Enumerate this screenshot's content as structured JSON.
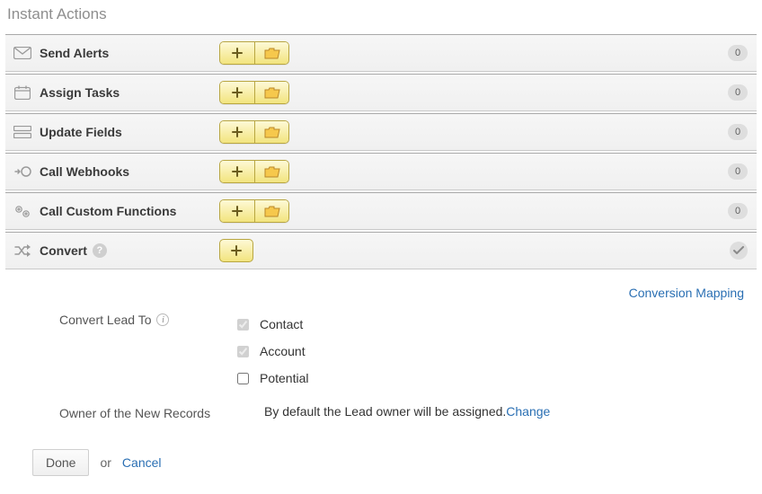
{
  "title": "Instant Actions",
  "rows": [
    {
      "label": "Send Alerts",
      "count": "0"
    },
    {
      "label": "Assign Tasks",
      "count": "0"
    },
    {
      "label": "Update Fields",
      "count": "0"
    },
    {
      "label": "Call Webhooks",
      "count": "0"
    },
    {
      "label": "Call Custom Functions",
      "count": "0"
    }
  ],
  "convert": {
    "label": "Convert",
    "mapping_link": "Conversion Mapping",
    "lead_to_label": "Convert Lead To",
    "options": {
      "contact": {
        "label": "Contact",
        "checked": true,
        "disabled": true
      },
      "account": {
        "label": "Account",
        "checked": true,
        "disabled": true
      },
      "potential": {
        "label": "Potential",
        "checked": false,
        "disabled": false
      }
    },
    "owner_label": "Owner of the New Records",
    "owner_text": "By default the Lead owner will be assigned.",
    "owner_change": "Change"
  },
  "footer": {
    "done": "Done",
    "or": "or",
    "cancel": "Cancel"
  }
}
